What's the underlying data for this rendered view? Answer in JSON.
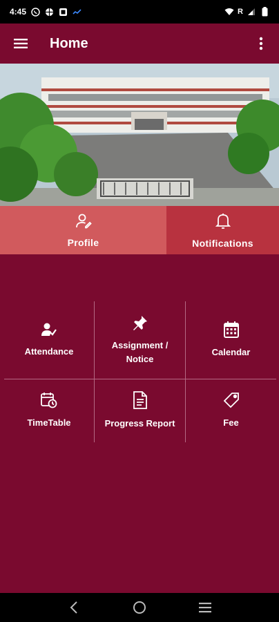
{
  "status_bar": {
    "time": "4:45",
    "carrier_indicator": "R",
    "icons": [
      "whatsapp-icon",
      "web-icon",
      "app-icon",
      "signal-indicator-icon",
      "wifi-icon",
      "cellular-signal-icon",
      "battery-icon"
    ]
  },
  "app_bar": {
    "title": "Home",
    "menu_icon": "hamburger-menu-icon",
    "more_icon": "overflow-menu-icon"
  },
  "tabs": [
    {
      "label": "Profile",
      "icon": "person-edit-icon",
      "color": "#d15a5d"
    },
    {
      "label": "Notifications",
      "icon": "bell-icon",
      "color": "#b8323f"
    }
  ],
  "menu_grid": [
    {
      "label": "Attendance",
      "icon": "user-check-icon"
    },
    {
      "label": "Assignment /\nNotice",
      "icon": "pushpin-icon"
    },
    {
      "label": "Calendar",
      "icon": "calendar-icon"
    },
    {
      "label": "TimeTable",
      "icon": "calendar-clock-icon"
    },
    {
      "label": "Progress Report",
      "icon": "document-icon"
    },
    {
      "label": "Fee",
      "icon": "price-tag-icon"
    }
  ],
  "nav_bar": {
    "buttons": [
      "back-icon",
      "home-icon",
      "recents-icon"
    ]
  },
  "colors": {
    "primary": "#7a0a2f",
    "tab_profile": "#d15a5d",
    "tab_notifications": "#b8323f"
  }
}
